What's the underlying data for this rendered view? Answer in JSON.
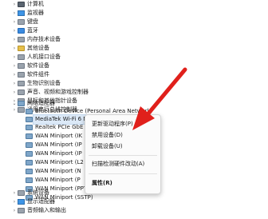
{
  "tree": {
    "items": [
      {
        "label": "计算机",
        "icon": "computer-icon"
      },
      {
        "label": "监视器",
        "icon": "monitor-icon"
      },
      {
        "label": "键盘",
        "icon": "keyboard-icon"
      },
      {
        "label": "蓝牙",
        "icon": "bluetooth-icon"
      },
      {
        "label": "内存技术设备",
        "icon": "memory-icon"
      },
      {
        "label": "其他设备",
        "icon": "other-devices-icon"
      },
      {
        "label": "人机接口设备",
        "icon": "hid-icon"
      },
      {
        "label": "软件设备",
        "icon": "software-device-icon"
      },
      {
        "label": "软件组件",
        "icon": "software-component-icon"
      },
      {
        "label": "生物识别设备",
        "icon": "biometric-icon"
      },
      {
        "label": "声音、视频和游戏控制器",
        "icon": "sound-icon"
      },
      {
        "label": "鼠标和其他指针设备",
        "icon": "mouse-icon"
      },
      {
        "label": "通用串行总线控制器",
        "icon": "usb-icon"
      },
      {
        "label": "网络适配器",
        "icon": "network-adapter-icon"
      },
      {
        "label": "Bluetooth Device (Personal Area Network)",
        "icon": "network-card-icon"
      },
      {
        "label": "MediaTek Wi-Fi 6 MT7921 Wireless LAN",
        "icon": "network-card-icon"
      },
      {
        "label": "Realtek PCIe GbE",
        "icon": "network-card-icon"
      },
      {
        "label": "WAN Miniport (IK",
        "icon": "network-card-icon"
      },
      {
        "label": "WAN Miniport (IP",
        "icon": "network-card-icon"
      },
      {
        "label": "WAN Miniport (IP",
        "icon": "network-card-icon"
      },
      {
        "label": "WAN Miniport (L2",
        "icon": "network-card-icon"
      },
      {
        "label": "WAN Miniport (N",
        "icon": "network-card-icon"
      },
      {
        "label": "WAN Miniport (P",
        "icon": "network-card-icon"
      },
      {
        "label": "WAN Miniport (PPTP)",
        "icon": "network-card-icon"
      },
      {
        "label": "WAN Miniport (SSTP)",
        "icon": "network-card-icon"
      },
      {
        "label": "系统设备",
        "icon": "system-device-icon"
      },
      {
        "label": "显示适配器",
        "icon": "display-adapter-icon"
      },
      {
        "label": "音频输入和输出",
        "icon": "audio-io-icon"
      }
    ]
  },
  "context_menu": {
    "update_driver": "更新驱动程序(P)",
    "disable_device": "禁用设备(D)",
    "uninstall_device": "卸载设备(U)",
    "scan_hardware": "扫描检测硬件改动(A)",
    "properties": "属性(R)"
  },
  "colors": {
    "selection": "#dce9f7",
    "annotation_arrow": "#e0201b"
  }
}
